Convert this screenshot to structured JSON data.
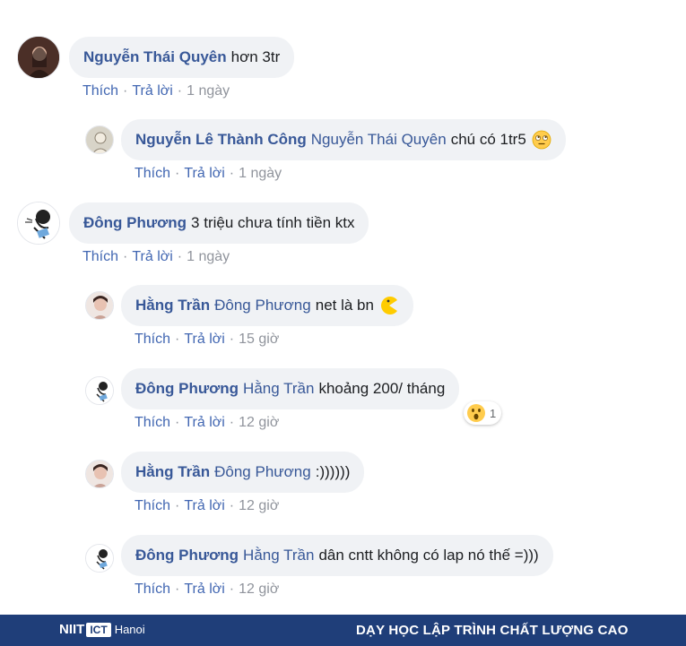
{
  "colors": {
    "link": "#385898",
    "bubble": "#f0f2f5",
    "footer": "#1f3e79"
  },
  "comments": [
    {
      "author": "Nguyễn Thái Quyên",
      "mention": "",
      "text": "hơn 3tr",
      "like": "Thích",
      "reply": "Trả lời",
      "time": "1 ngày",
      "avatar_icon": "user-avatar-photo"
    },
    {
      "author": "Nguyễn Lê Thành Công",
      "mention": "Nguyễn Thái Quyên",
      "text": "chú có 1tr5",
      "emoji": "rolling-eyes-emoji",
      "like": "Thích",
      "reply": "Trả lời",
      "time": "1 ngày",
      "avatar_icon": "user-avatar-photo"
    },
    {
      "author": "Đông Phương",
      "mention": "",
      "text": "3 triệu chưa tính tiền ktx",
      "like": "Thích",
      "reply": "Trả lời",
      "time": "1 ngày",
      "avatar_icon": "user-avatar-sketch"
    },
    {
      "author": "Hằng Trần",
      "mention": "Đông Phương",
      "text": "net là bn",
      "emoji": "pacman-emoji",
      "like": "Thích",
      "reply": "Trả lời",
      "time": "15 giờ",
      "avatar_icon": "user-avatar-photo"
    },
    {
      "author": "Đông Phương",
      "mention": "Hằng Trần",
      "text": "khoảng 200/ tháng",
      "like": "Thích",
      "reply": "Trả lời",
      "time": "12 giờ",
      "reaction": {
        "icon": "wow-reaction-icon",
        "count": "1"
      },
      "avatar_icon": "user-avatar-sketch"
    },
    {
      "author": "Hằng Trần",
      "mention": "Đông Phương",
      "text": ":))))))",
      "like": "Thích",
      "reply": "Trả lời",
      "time": "12 giờ",
      "avatar_icon": "user-avatar-photo"
    },
    {
      "author": "Đông Phương",
      "mention": "Hằng Trần",
      "text": "dân cntt không có lap nó thế =)))",
      "like": "Thích",
      "reply": "Trả lời",
      "time": "12 giờ",
      "avatar_icon": "user-avatar-sketch"
    }
  ],
  "footer": {
    "logo_left": "NIIT",
    "logo_box": "ICT",
    "logo_city": "Hanoi",
    "slogan": "DẠY HỌC LẬP TRÌNH CHẤT LƯỢNG CAO"
  }
}
